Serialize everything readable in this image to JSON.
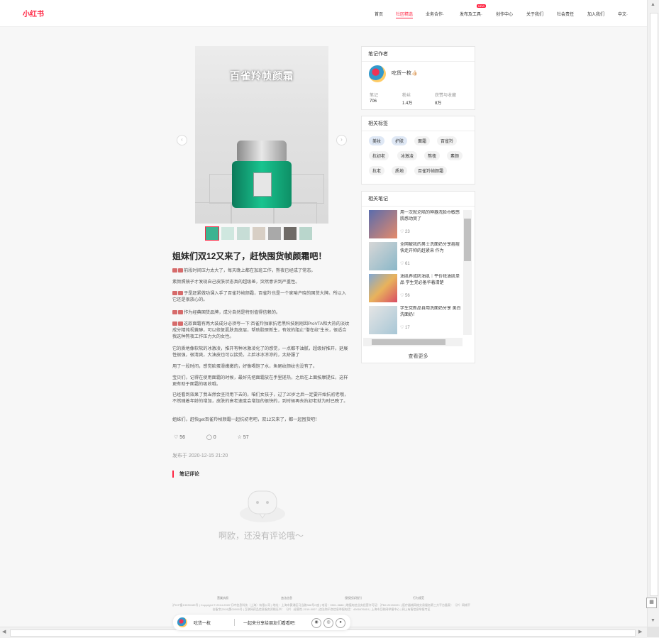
{
  "app": {
    "logo": "小红书"
  },
  "nav": {
    "items": [
      "首页",
      "社区精选",
      "业务合作·",
      "发布及工具·",
      "创作中心",
      "关于我们",
      "社会责任",
      "加入我们",
      "中文·"
    ],
    "active_index": 1,
    "badge": "NEW"
  },
  "note": {
    "image_overlay_text": "百雀羚帧颜霜",
    "title": "姐妹们双12又来了，赶快囤货帧颜霜吧！",
    "paragraphs": [
      "前段时间压力太大了，每天晚上都在加班工作，熬夜已经成了常态。",
      "素颜照镜子才发现自己皮肤状态真的超级差，突然意识到严重性。",
      "于是赶紧做功课入手了百雀羚帧颜霜，百雀羚也是一个家喻户晓的国货大牌。所以入它还是很放心的。",
      "作为经典国货品牌，成分自然是特别值得信赖的。",
      "这款面霜有两大装成分必须夸一下:百雀羚独家抗老黑科技刚刚因ProVTA和大热的淡纹成分精纯视黄醇，可以修复肌肤真皮层，帮助胶原新生，有效的阻止“潜在纹”生长，很适合我这种熬夜工作压力大的女性。",
      "它的质地像软软的冰激凌，推开有种冰激凌化了的感觉，一点都不油腻，超级好推开，延展性很强，很清爽，大油皮也可以接受。上脸冰冰凉凉的，太舒服了",
      "用了一段时间，感觉脸蛋滑嫩嫩的，好像喝饱了水，鱼尾纹颜纹也没有了。",
      "宝贝们，记得在使用面霜的时候，最好先把面霜放在手里搓热，之后在上面按摩提拉，这样更有助于面霜的吸收哦。",
      "已经看到效果了我当然会坚持用下去的，咱们女孩子，过了20岁之后一定要开始抗初老哦，不然随着年龄的增加，皮肤的衰老速度会增加的很快的，到时候再去抗初老就为时已晚了。",
      "姐妹们，赶快get百雀羚帧颜霜一起抗初老吧，双12又来了，都一起囤货吧！"
    ],
    "likes": "56",
    "comments": "0",
    "collects": "57",
    "published": "发布于 2020-12-15 21:20",
    "comments_title": "笔记评论",
    "empty_comments": "啊欧，还没有评论哦～"
  },
  "author_card": {
    "header": "笔记作者",
    "name": "吃货一枚👍🏻",
    "stats": [
      {
        "label": "笔记",
        "value": "706"
      },
      {
        "label": "粉丝",
        "value": "1.4万"
      },
      {
        "label": "获赞与收藏",
        "value": "8万"
      }
    ]
  },
  "tags_card": {
    "header": "相关标签",
    "tags": [
      "美妆",
      "护肤",
      "面霜",
      "百雀羚",
      "抗初老",
      "冰激凌",
      "熬夜",
      "素颜",
      "抗老",
      "质地",
      "百雀羚帧颜霜"
    ]
  },
  "related_card": {
    "header": "相关笔记",
    "notes": [
      {
        "title": "用一次就沦陷的神器洗脸巾敏感肌感动哭了",
        "likes": "23"
      },
      {
        "title": "全网被我的男士洗面奶分享痘痘快走开帅的赶紧来 作为",
        "likes": "61"
      },
      {
        "title": "油肌养成防油肌｜平价祛油肌单品 学生党必备华着清楚",
        "likes": "56"
      },
      {
        "title": "学生党新品自用洗面奶分享 美白洗面奶！",
        "likes": "17"
      }
    ],
    "see_more": "查看更多"
  },
  "footer": {
    "links": [
      "营業执照",
      "违法信息",
      "侵权投诉指引",
      "行为规范"
    ],
    "legal": "沪ICP备13030189号 | Copyright © 2014-2020 行吟信息科技（上海）有限公司 | 地址：上海市黄浦区马当路388号C座 | 电话：9501-3888 | 增值电信业务经营许可证：沪B2-20150021 | 医疗器械网络交易服务第三方平台备案：（沪）网械平台备字[2019]第00006号 | 互联网药品信息服务资格证书：（沪）-经营性-2019-0007 | 违法和不良信息举报电话：4006676810 | 上海市互联网举报中心 | 网上有害信息举报专区"
  },
  "share_bar": {
    "name": "吃货一枚",
    "prompt": "一起来分享给朋友们看看吧:"
  }
}
